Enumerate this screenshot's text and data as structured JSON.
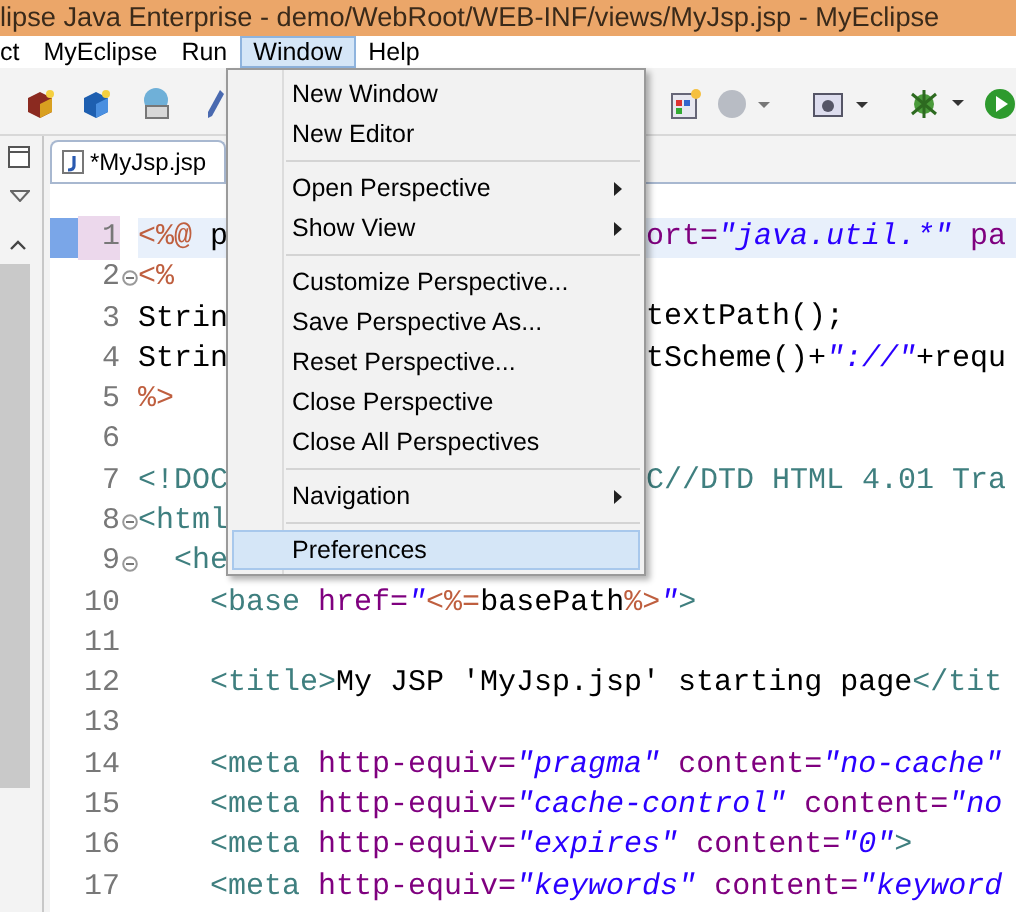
{
  "window": {
    "title": "lipse Java Enterprise - demo/WebRoot/WEB-INF/views/MyJsp.jsp - MyEclipse"
  },
  "menu_bar": [
    {
      "label": "ct",
      "selected": false
    },
    {
      "label": "MyEclipse",
      "selected": false
    },
    {
      "label": "Run",
      "selected": false
    },
    {
      "label": "Window",
      "selected": true
    },
    {
      "label": "Help",
      "selected": false
    }
  ],
  "editor_tab": {
    "label": "*MyJsp.jsp"
  },
  "code_lines": [
    {
      "number": "1",
      "current": true,
      "fold": false,
      "left": [
        {
          "kind": "scriptlet",
          "text": "<%@ "
        },
        {
          "kind": "text",
          "text": "p"
        }
      ],
      "right": [
        {
          "kind": "attr",
          "text": "ort="
        },
        {
          "kind": "string",
          "text": "\"java.util.*\""
        },
        {
          "kind": "attr",
          "text": " pa"
        }
      ]
    },
    {
      "number": "2",
      "current": false,
      "fold": true,
      "left": [
        {
          "kind": "scriptlet",
          "text": "<%"
        }
      ]
    },
    {
      "number": "3",
      "current": false,
      "fold": false,
      "left": [
        {
          "kind": "text",
          "text": "Strin"
        }
      ],
      "right": [
        {
          "kind": "text",
          "text": "textPath();"
        }
      ]
    },
    {
      "number": "4",
      "current": false,
      "fold": false,
      "left": [
        {
          "kind": "text",
          "text": "Strin"
        }
      ],
      "right": [
        {
          "kind": "text",
          "text": "tScheme()+"
        },
        {
          "kind": "string",
          "text": "\"://\""
        },
        {
          "kind": "text",
          "text": "+requ"
        }
      ]
    },
    {
      "number": "5",
      "current": false,
      "fold": false,
      "left": [
        {
          "kind": "scriptlet",
          "text": "%>"
        }
      ]
    },
    {
      "number": "6",
      "current": false,
      "fold": false
    },
    {
      "number": "7",
      "current": false,
      "fold": false,
      "left": [
        {
          "kind": "tag",
          "text": "<!DOC"
        }
      ],
      "right": [
        {
          "kind": "tag",
          "text": "C//DTD HTML 4.01 Tra"
        }
      ]
    },
    {
      "number": "8",
      "current": false,
      "fold": true,
      "left": [
        {
          "kind": "tag",
          "text": "<html"
        }
      ]
    },
    {
      "number": "9",
      "current": false,
      "fold": true,
      "left": [
        {
          "kind": "tag",
          "text": "  <he"
        }
      ]
    },
    {
      "number": "10",
      "current": false,
      "fold": false,
      "left": [
        {
          "kind": "tag",
          "text": "    <base "
        },
        {
          "kind": "attr",
          "text": "href="
        },
        {
          "kind": "string",
          "text": "\""
        },
        {
          "kind": "scriptlet",
          "text": "<%="
        },
        {
          "kind": "text",
          "text": "basePath"
        },
        {
          "kind": "scriptlet",
          "text": "%>"
        },
        {
          "kind": "string",
          "text": "\""
        },
        {
          "kind": "tag",
          "text": ">"
        }
      ]
    },
    {
      "number": "11",
      "current": false,
      "fold": false
    },
    {
      "number": "12",
      "current": false,
      "fold": false,
      "left": [
        {
          "kind": "tag",
          "text": "    <title>"
        },
        {
          "kind": "text",
          "text": "My JSP 'MyJsp.jsp' starting page"
        },
        {
          "kind": "tag",
          "text": "</tit"
        }
      ]
    },
    {
      "number": "13",
      "current": false,
      "fold": false
    },
    {
      "number": "14",
      "current": false,
      "fold": false,
      "left": [
        {
          "kind": "tag",
          "text": "    <meta "
        },
        {
          "kind": "attr",
          "text": "http-equiv="
        },
        {
          "kind": "string",
          "text": "\"pragma\""
        },
        {
          "kind": "attr",
          "text": " content="
        },
        {
          "kind": "string",
          "text": "\"no-cache\""
        }
      ]
    },
    {
      "number": "15",
      "current": false,
      "fold": false,
      "left": [
        {
          "kind": "tag",
          "text": "    <meta "
        },
        {
          "kind": "attr",
          "text": "http-equiv="
        },
        {
          "kind": "string",
          "text": "\"cache-control\""
        },
        {
          "kind": "attr",
          "text": " content="
        },
        {
          "kind": "string",
          "text": "\"no"
        }
      ]
    },
    {
      "number": "16",
      "current": false,
      "fold": false,
      "left": [
        {
          "kind": "tag",
          "text": "    <meta "
        },
        {
          "kind": "attr",
          "text": "http-equiv="
        },
        {
          "kind": "string",
          "text": "\"expires\""
        },
        {
          "kind": "attr",
          "text": " content="
        },
        {
          "kind": "string",
          "text": "\"0\""
        },
        {
          "kind": "tag",
          "text": ">"
        }
      ]
    },
    {
      "number": "17",
      "current": false,
      "fold": false,
      "left": [
        {
          "kind": "tag",
          "text": "    <meta "
        },
        {
          "kind": "attr",
          "text": "http-equiv="
        },
        {
          "kind": "string",
          "text": "\"keywords\""
        },
        {
          "kind": "attr",
          "text": " content="
        },
        {
          "kind": "string",
          "text": "\"keyword"
        }
      ]
    }
  ],
  "window_menu": [
    {
      "kind": "item",
      "label": "New Window",
      "submenu": false,
      "selected": false
    },
    {
      "kind": "item",
      "label": "New Editor",
      "submenu": false,
      "selected": false
    },
    {
      "kind": "separator"
    },
    {
      "kind": "item",
      "label": "Open Perspective",
      "submenu": true,
      "selected": false
    },
    {
      "kind": "item",
      "label": "Show View",
      "submenu": true,
      "selected": false
    },
    {
      "kind": "separator"
    },
    {
      "kind": "item",
      "label": "Customize Perspective...",
      "submenu": false,
      "selected": false
    },
    {
      "kind": "item",
      "label": "Save Perspective As...",
      "submenu": false,
      "selected": false
    },
    {
      "kind": "item",
      "label": "Reset Perspective...",
      "submenu": false,
      "selected": false
    },
    {
      "kind": "item",
      "label": "Close Perspective",
      "submenu": false,
      "selected": false
    },
    {
      "kind": "item",
      "label": "Close All Perspectives",
      "submenu": false,
      "selected": false
    },
    {
      "kind": "separator"
    },
    {
      "kind": "item",
      "label": "Navigation",
      "submenu": true,
      "selected": false
    },
    {
      "kind": "separator"
    },
    {
      "kind": "item",
      "label": "Preferences",
      "submenu": false,
      "selected": true
    }
  ]
}
